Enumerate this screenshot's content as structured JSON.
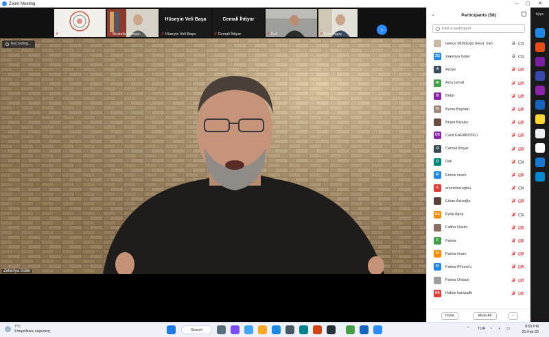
{
  "window": {
    "title": "Zoom Meeting"
  },
  "strip": {
    "thumbs": [
      {
        "name": "İskeçe Müftülüğü",
        "kind": "logo"
      },
      {
        "name": "Mustafa Trampa",
        "kind": "video"
      },
      {
        "name": "Hüseyin Veli Başa",
        "kind": "text",
        "big": "Hüseyin Veli Başa"
      },
      {
        "name": "Cemali İhtiyar",
        "kind": "text",
        "big": "Cemali İhtiyar"
      },
      {
        "name": "Deli",
        "kind": "video"
      },
      {
        "name": "Eyüp Aguş",
        "kind": "video"
      }
    ]
  },
  "main": {
    "recording_label": "Recording...",
    "speaker_name": "Zekeriya Güler"
  },
  "panel": {
    "title": "Participants (58)",
    "search_placeholder": "Find a participant",
    "participants": [
      {
        "name": "İskeçe Müftülüğü (Host, me)",
        "initials": "",
        "color": "#c9b9a5",
        "photo": true,
        "mic": "on",
        "cam": "on"
      },
      {
        "name": "Zekeriya Güler",
        "initials": "ZG",
        "color": "#1e88e5",
        "photo": false,
        "mic": "on",
        "cam": "on"
      },
      {
        "name": "Arziye",
        "initials": "A",
        "color": "#3b4a5a",
        "photo": false,
        "mic": "muted",
        "cam": "off"
      },
      {
        "name": "Arzu İsmail",
        "initials": "AI",
        "color": "#43a047",
        "photo": false,
        "mic": "muted",
        "cam": "off"
      },
      {
        "name": "Betül",
        "initials": "B",
        "color": "#8e24aa",
        "photo": false,
        "mic": "muted",
        "cam": "off"
      },
      {
        "name": "Busra Bayram",
        "initials": "B",
        "color": "#a1887f",
        "photo": false,
        "mic": "muted",
        "cam": "off"
      },
      {
        "name": "Büşra Biçakçı",
        "initials": "",
        "color": "#6d4c41",
        "photo": true,
        "mic": "muted",
        "cam": "off"
      },
      {
        "name": "Cavit KARABIYIKLI",
        "initials": "CK",
        "color": "#8e24aa",
        "photo": false,
        "mic": "muted",
        "cam": "off"
      },
      {
        "name": "Cemali İhtiyar",
        "initials": "CI",
        "color": "#37474f",
        "photo": false,
        "mic": "muted",
        "cam": "off"
      },
      {
        "name": "Deli",
        "initials": "D",
        "color": "#00897b",
        "photo": false,
        "mic": "muted",
        "cam": "on"
      },
      {
        "name": "Emine imam",
        "initials": "EI",
        "color": "#1e88e5",
        "photo": false,
        "mic": "muted",
        "cam": "off"
      },
      {
        "name": "eminebozoglou",
        "initials": "E",
        "color": "#e53935",
        "photo": false,
        "mic": "muted",
        "cam": "on"
      },
      {
        "name": "Erkan Azizoğlu",
        "initials": "",
        "color": "#5d4037",
        "photo": true,
        "mic": "muted",
        "cam": "off"
      },
      {
        "name": "Eyüp Aguş",
        "initials": "EA",
        "color": "#fb8c00",
        "photo": false,
        "mic": "muted",
        "cam": "on"
      },
      {
        "name": "Fatiha Husko",
        "initials": "",
        "color": "#8d6e63",
        "photo": true,
        "mic": "muted",
        "cam": "off"
      },
      {
        "name": "Fatma",
        "initials": "F",
        "color": "#43a047",
        "photo": false,
        "mic": "muted",
        "cam": "off"
      },
      {
        "name": "Fatma imam",
        "initials": "FI",
        "color": "#fb8c00",
        "photo": false,
        "mic": "muted",
        "cam": "off"
      },
      {
        "name": "Fatma iPhone'u",
        "initials": "FI",
        "color": "#1e88e5",
        "photo": false,
        "mic": "muted",
        "cam": "off"
      },
      {
        "name": "Fatma Onbasi",
        "initials": "",
        "color": "#9e9e9e",
        "photo": true,
        "mic": "muted",
        "cam": "off"
      },
      {
        "name": "Hafize karasalih",
        "initials": "HK",
        "color": "#e53935",
        "photo": false,
        "mic": "muted",
        "cam": "off"
      }
    ],
    "invite_label": "Invite",
    "mute_all_label": "Mute All",
    "more_label": "···"
  },
  "apps_bar": {
    "title": "Apps"
  },
  "taskbar": {
    "weather_temp": "7°C",
    "weather_desc": "Σποραδικές νεφώσεις",
    "search_label": "Search",
    "language": "TUR",
    "time": "8:55 PM",
    "date": "21-Feb-23"
  },
  "colors": {
    "accent": "#2d8cff",
    "muted_red": "#e5383b",
    "panel_bg": "#ffffff"
  }
}
